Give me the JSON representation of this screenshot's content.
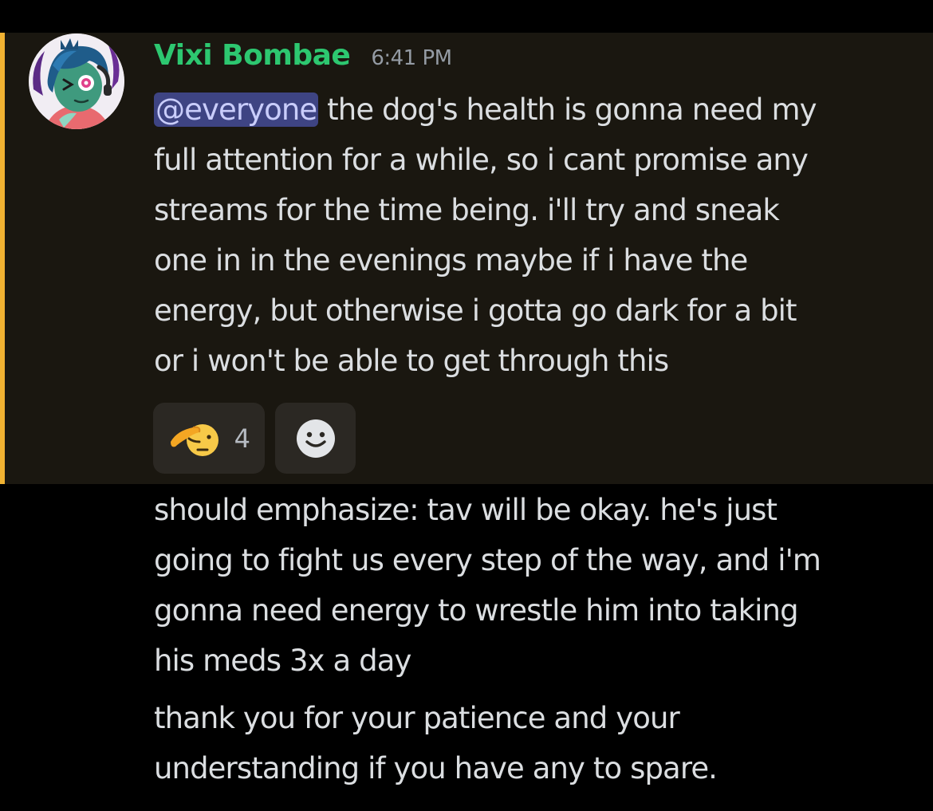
{
  "message": {
    "author": "Vixi Bombae",
    "timestamp": "6:41 PM",
    "mention": "@everyone",
    "lines": [
      " the dog's health is gonna need my",
      "full attention for a while, so i cant promise any",
      "streams for the time being. i'll try and sneak",
      "one in in the evenings maybe if i have the",
      "energy, but otherwise i gotta go dark for a bit",
      "or i won't be able to get through this"
    ],
    "reactions": [
      {
        "emoji": "salute-emoji",
        "count": "4"
      }
    ],
    "add_reaction_icon": "smiley-icon"
  },
  "followups": [
    {
      "lines": [
        "should emphasize: tav will be okay. he's just",
        "going to fight us every step of the way, and i'm",
        "gonna need energy to wrestle him into taking",
        "his meds 3x a day"
      ]
    },
    {
      "lines": [
        "thank you for your patience and your",
        "understanding if you have any to spare."
      ]
    }
  ],
  "colors": {
    "author": "#2dc770",
    "mention_bg": "#3e4483",
    "highlight_bar": "#f0b232",
    "highlight_bg": "#1a1710",
    "text": "#dbdee1"
  }
}
